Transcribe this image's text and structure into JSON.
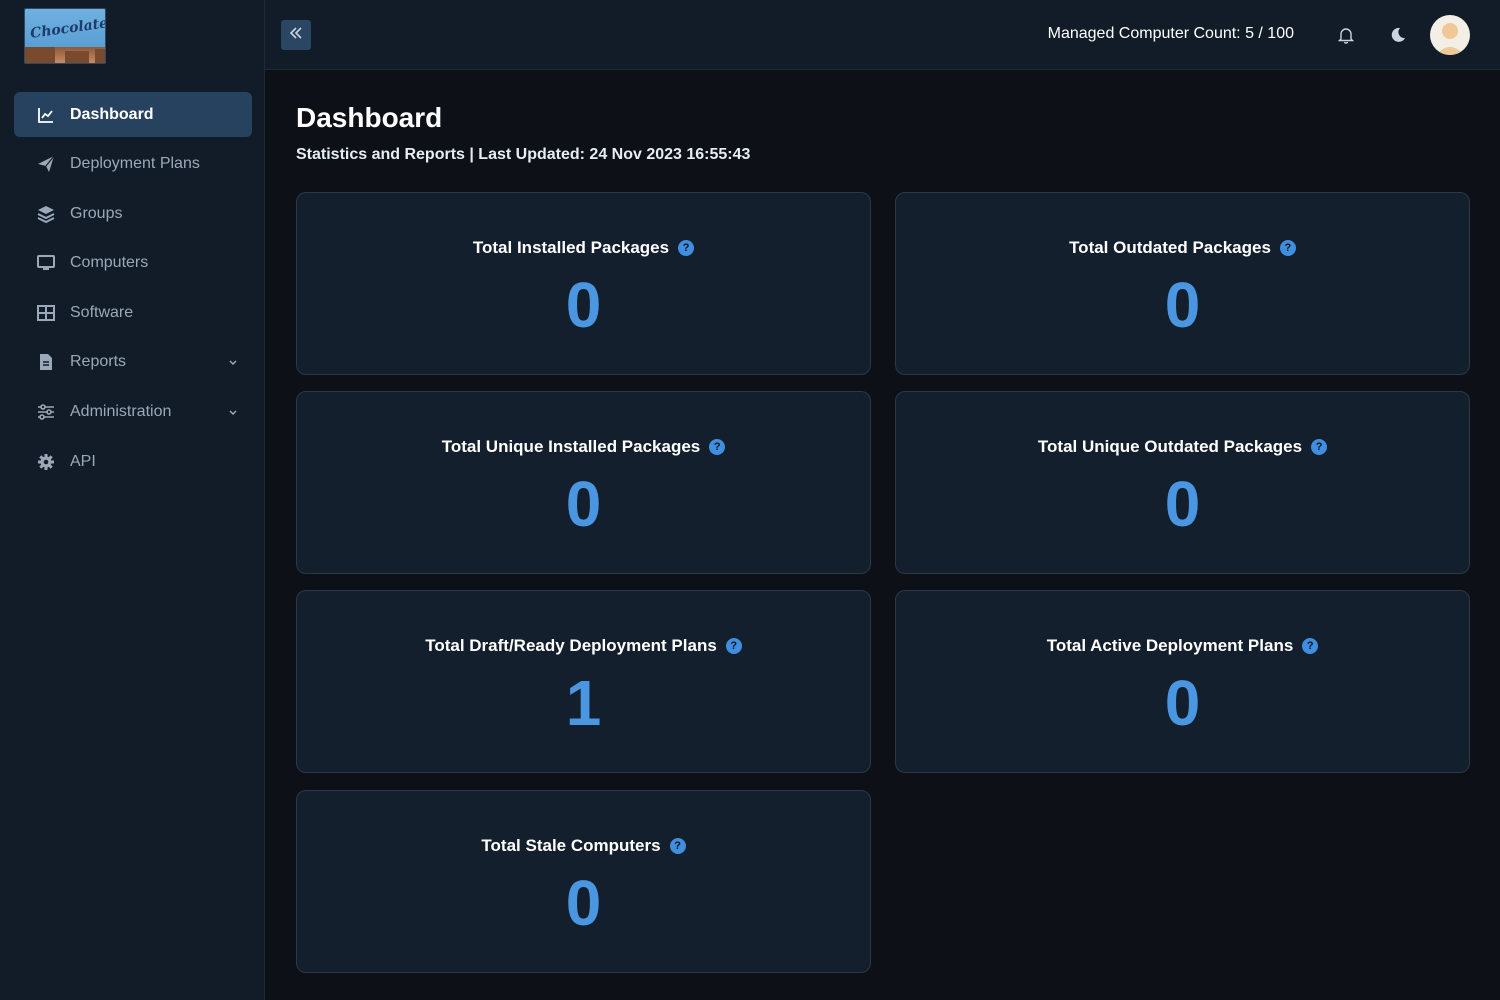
{
  "app": {
    "logo_text": "Chocolatey",
    "accent": "#4a96e0"
  },
  "sidebar": {
    "items": [
      {
        "label": "Dashboard",
        "icon": "chart-line-icon",
        "active": true
      },
      {
        "label": "Deployment Plans",
        "icon": "paper-plane-icon"
      },
      {
        "label": "Groups",
        "icon": "layers-icon"
      },
      {
        "label": "Computers",
        "icon": "monitor-icon"
      },
      {
        "label": "Software",
        "icon": "grid-icon"
      },
      {
        "label": "Reports",
        "icon": "file-icon",
        "expandable": true
      },
      {
        "label": "Administration",
        "icon": "sliders-icon",
        "expandable": true
      },
      {
        "label": "API",
        "icon": "gear-icon"
      }
    ]
  },
  "header": {
    "managed_count": "Managed Computer Count: 5 / 100"
  },
  "main": {
    "title": "Dashboard",
    "subtitle": "Statistics and Reports | Last Updated: 24 Nov 2023 16:55:43",
    "cards": [
      {
        "title": "Total Installed Packages",
        "value": "0"
      },
      {
        "title": "Total Outdated Packages",
        "value": "0"
      },
      {
        "title": "Total Unique Installed Packages",
        "value": "0"
      },
      {
        "title": "Total Unique Outdated Packages",
        "value": "0"
      },
      {
        "title": "Total Draft/Ready Deployment Plans",
        "value": "1"
      },
      {
        "title": "Total Active Deployment Plans",
        "value": "0"
      },
      {
        "title": "Total Stale Computers",
        "value": "0"
      }
    ],
    "help_glyph": "?"
  }
}
